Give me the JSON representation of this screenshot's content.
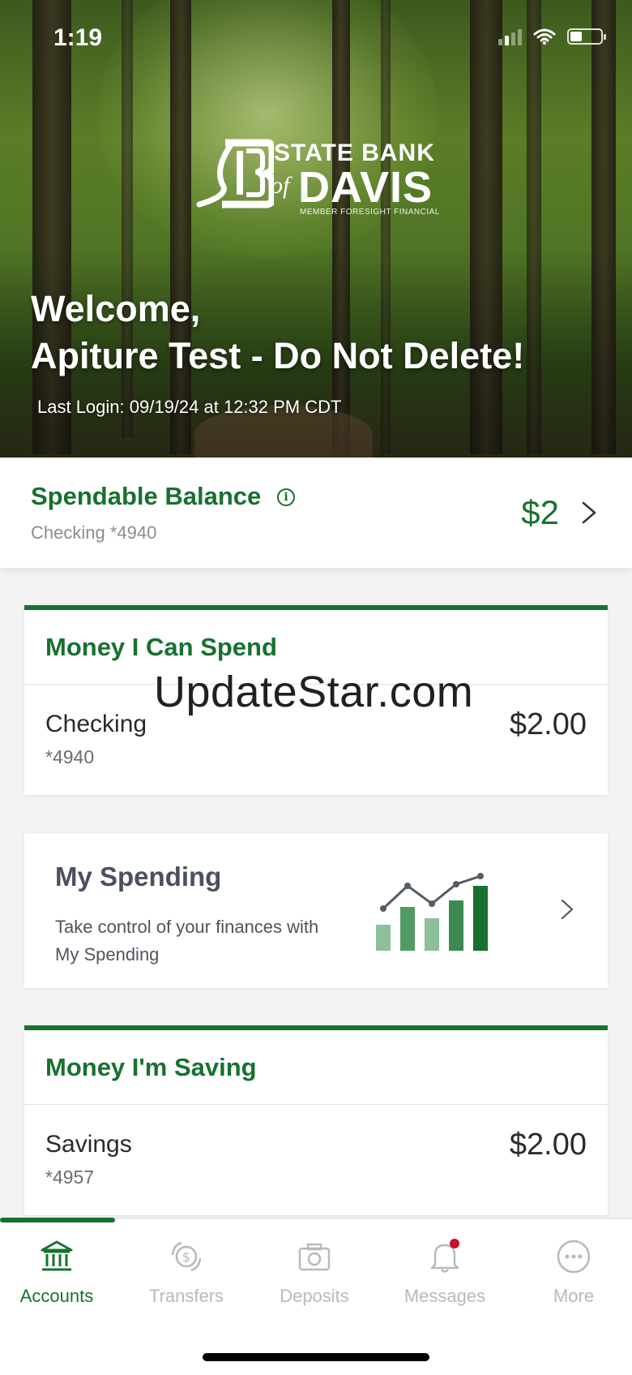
{
  "status_bar": {
    "time": "1:19"
  },
  "brand": {
    "name_line1": "STATE BANK",
    "name_of": "of",
    "name_line2": "DAVIS",
    "tagline": "MEMBER FORESIGHT FINANCIAL"
  },
  "welcome": {
    "line1": "Welcome,",
    "line2": "Apiture Test - Do Not Delete!",
    "last_login": "Last Login: 09/19/24 at 12:32 PM CDT"
  },
  "spendable": {
    "title": "Spendable Balance",
    "account": "Checking *4940",
    "amount": "$2"
  },
  "money_spend": {
    "title": "Money I Can Spend",
    "accounts": [
      {
        "name": "Checking",
        "number": "*4940",
        "amount": "$2.00"
      }
    ]
  },
  "watermark": "UpdateStar.com",
  "my_spending": {
    "title": "My Spending",
    "description": "Take control of your finances with My Spending"
  },
  "money_saving": {
    "title": "Money I'm Saving",
    "accounts": [
      {
        "name": "Savings",
        "number": "*4957",
        "amount": "$2.00"
      }
    ]
  },
  "tabs": [
    {
      "label": "Accounts",
      "icon": "bank-icon",
      "active": true
    },
    {
      "label": "Transfers",
      "icon": "transfer-dollar-icon",
      "active": false
    },
    {
      "label": "Deposits",
      "icon": "camera-icon",
      "active": false
    },
    {
      "label": "Messages",
      "icon": "bell-icon",
      "active": false,
      "badge": true
    },
    {
      "label": "More",
      "icon": "more-icon",
      "active": false
    }
  ],
  "colors": {
    "brand_green": "#17712f",
    "badge_red": "#c8102e",
    "inactive_tab": "#b9b9b9"
  }
}
